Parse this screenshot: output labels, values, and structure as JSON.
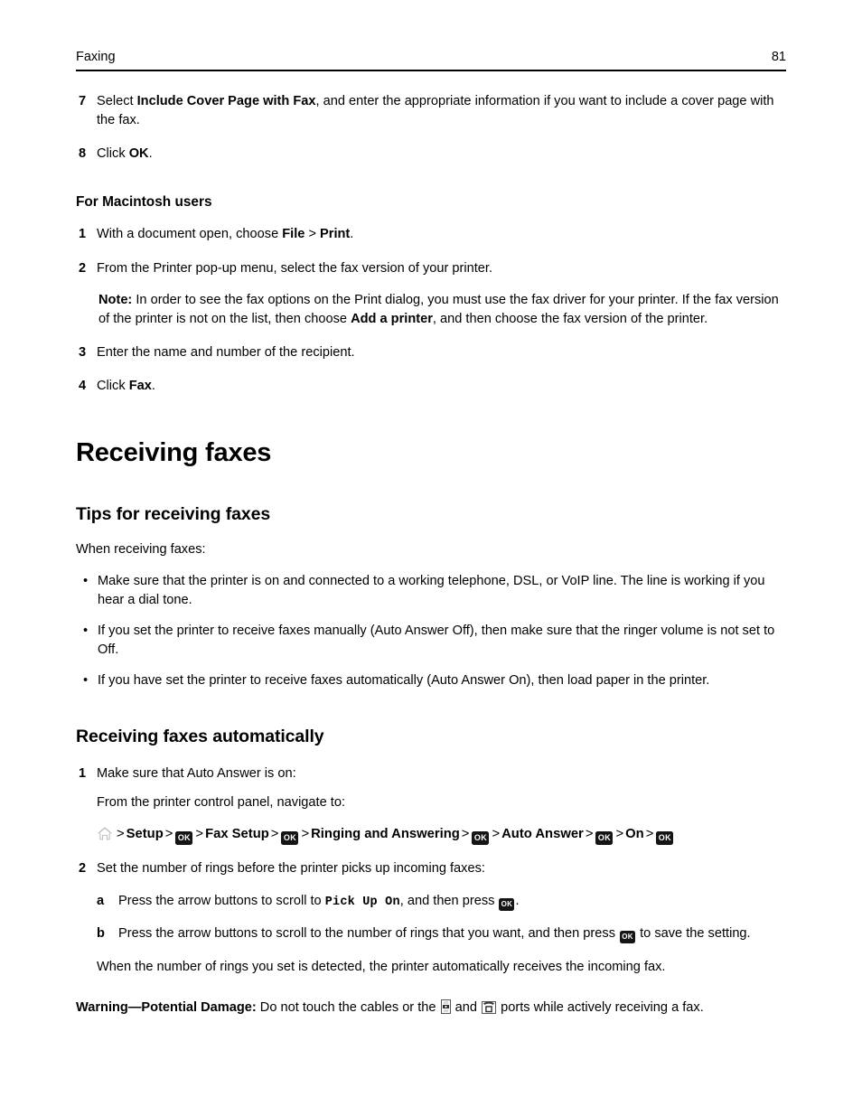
{
  "header": {
    "title": "Faxing",
    "page_number": "81"
  },
  "icons": {
    "home": "home-icon",
    "ok_key": "OK",
    "line_port": "line-port-icon",
    "ext_port": "ext-port-icon",
    "bullet": "•",
    "separator": ">"
  },
  "colors": {
    "text": "#000000",
    "rule": "#000000",
    "key_background": "#151515",
    "key_foreground": "#ffffff",
    "home_icon": "#b3b3b3"
  },
  "top_steps": [
    {
      "num": "7",
      "parts": [
        {
          "t": "Select ",
          "b": false
        },
        {
          "t": "Include Cover Page with Fax",
          "b": true
        },
        {
          "t": ", and enter the appropriate information if you want to include a cover page with the fax.",
          "b": false
        }
      ]
    },
    {
      "num": "8",
      "parts": [
        {
          "t": "Click ",
          "b": false
        },
        {
          "t": "OK",
          "b": true
        },
        {
          "t": ".",
          "b": false
        }
      ]
    }
  ],
  "macintosh": {
    "heading": "For Macintosh users",
    "step1": {
      "num": "1",
      "parts": [
        {
          "t": "With a document open, choose ",
          "b": false
        },
        {
          "t": "File",
          "b": true
        },
        {
          "t": " > ",
          "b": false
        },
        {
          "t": "Print",
          "b": true
        },
        {
          "t": ".",
          "b": false
        }
      ]
    },
    "step2": {
      "num": "2",
      "text": "From the Printer pop-up menu, select the fax version of your printer."
    },
    "note": {
      "label": "Note:",
      "parts": [
        {
          "t": " In order to see the fax options on the Print dialog, you must use the fax driver for your printer. If the fax version of the printer is not on the list, then choose ",
          "b": false
        },
        {
          "t": "Add a printer",
          "b": true
        },
        {
          "t": ", and then choose the fax version of the printer.",
          "b": false
        }
      ]
    },
    "step3": {
      "num": "3",
      "text": "Enter the name and number of the recipient."
    },
    "step4": {
      "num": "4",
      "parts": [
        {
          "t": "Click ",
          "b": false
        },
        {
          "t": "Fax",
          "b": true
        },
        {
          "t": ".",
          "b": false
        }
      ]
    }
  },
  "section": {
    "title": "Receiving faxes",
    "tips": {
      "heading": "Tips for receiving faxes",
      "intro": "When receiving faxes:",
      "bullets": [
        "Make sure that the printer is on and connected to a working telephone, DSL, or VoIP line. The line is working if you hear a dial tone.",
        "If you set the printer to receive faxes manually (Auto Answer Off), then make sure that the ringer volume is not set to Off.",
        "If you have set the printer to receive faxes automatically (Auto Answer On), then load paper in the printer."
      ]
    },
    "auto": {
      "heading": "Receiving faxes automatically",
      "step1": {
        "num": "1",
        "line1": "Make sure that Auto Answer is on:",
        "line2": "From the printer control panel, navigate to:",
        "navpath": [
          {
            "type": "icon",
            "value": "home-icon"
          },
          {
            "type": "sep",
            "value": ">"
          },
          {
            "type": "label",
            "value": "Setup"
          },
          {
            "type": "sep",
            "value": ">"
          },
          {
            "type": "key",
            "value": "OK"
          },
          {
            "type": "sep",
            "value": ">"
          },
          {
            "type": "label",
            "value": "Fax Setup"
          },
          {
            "type": "sep",
            "value": ">"
          },
          {
            "type": "key",
            "value": "OK"
          },
          {
            "type": "sep",
            "value": ">"
          },
          {
            "type": "label",
            "value": "Ringing and Answering"
          },
          {
            "type": "sep",
            "value": ">"
          },
          {
            "type": "key",
            "value": "OK"
          },
          {
            "type": "sep",
            "value": ">"
          },
          {
            "type": "label",
            "value": "Auto Answer"
          },
          {
            "type": "sep",
            "value": ">"
          },
          {
            "type": "key",
            "value": "OK"
          },
          {
            "type": "sep",
            "value": ">"
          },
          {
            "type": "label",
            "value": "On"
          },
          {
            "type": "sep",
            "value": ">"
          },
          {
            "type": "key",
            "value": "OK"
          }
        ]
      },
      "step2": {
        "num": "2",
        "text": "Set the number of rings before the printer picks up incoming faxes:",
        "sub_a": {
          "alpha": "a",
          "prefix": "Press the arrow buttons to scroll to ",
          "mono": "Pick Up On",
          "middle": ", and then press ",
          "key": "OK",
          "suffix": "."
        },
        "sub_b": {
          "alpha": "b",
          "prefix": "Press the arrow buttons to scroll to the number of rings that you want, and then press ",
          "key": "OK",
          "suffix": " to save the setting."
        },
        "closing": "When the number of rings you set is detected, the printer automatically receives the incoming fax."
      }
    },
    "warning": {
      "label": "Warning—Potential Damage:",
      "part1": " Do not touch the cables or the ",
      "part2": " and ",
      "part3": " ports while actively receiving a fax."
    }
  }
}
